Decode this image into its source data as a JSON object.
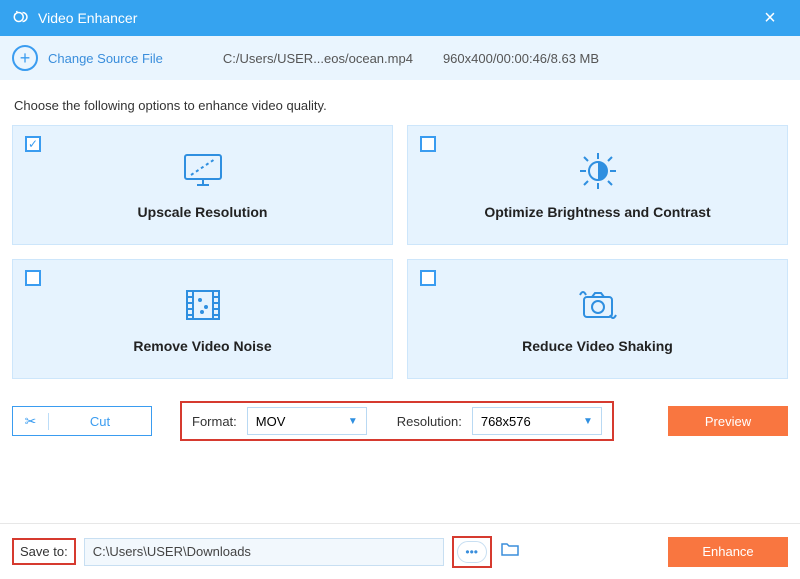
{
  "titlebar": {
    "title": "Video Enhancer"
  },
  "source": {
    "change_label": "Change Source File",
    "path": "C:/Users/USER...eos/ocean.mp4",
    "meta": "960x400/00:00:46/8.63 MB"
  },
  "instruction": "Choose the following options to enhance video quality.",
  "cards": {
    "upscale": {
      "label": "Upscale Resolution",
      "checked": true
    },
    "bright": {
      "label": "Optimize Brightness and Contrast",
      "checked": false
    },
    "noise": {
      "label": "Remove Video Noise",
      "checked": false
    },
    "shaking": {
      "label": "Reduce Video Shaking",
      "checked": false
    }
  },
  "controls": {
    "cut_label": "Cut",
    "format_label": "Format:",
    "format_value": "MOV",
    "resolution_label": "Resolution:",
    "resolution_value": "768x576",
    "preview_label": "Preview"
  },
  "footer": {
    "saveto_label": "Save to:",
    "save_path": "C:\\Users\\USER\\Downloads",
    "enhance_label": "Enhance"
  }
}
